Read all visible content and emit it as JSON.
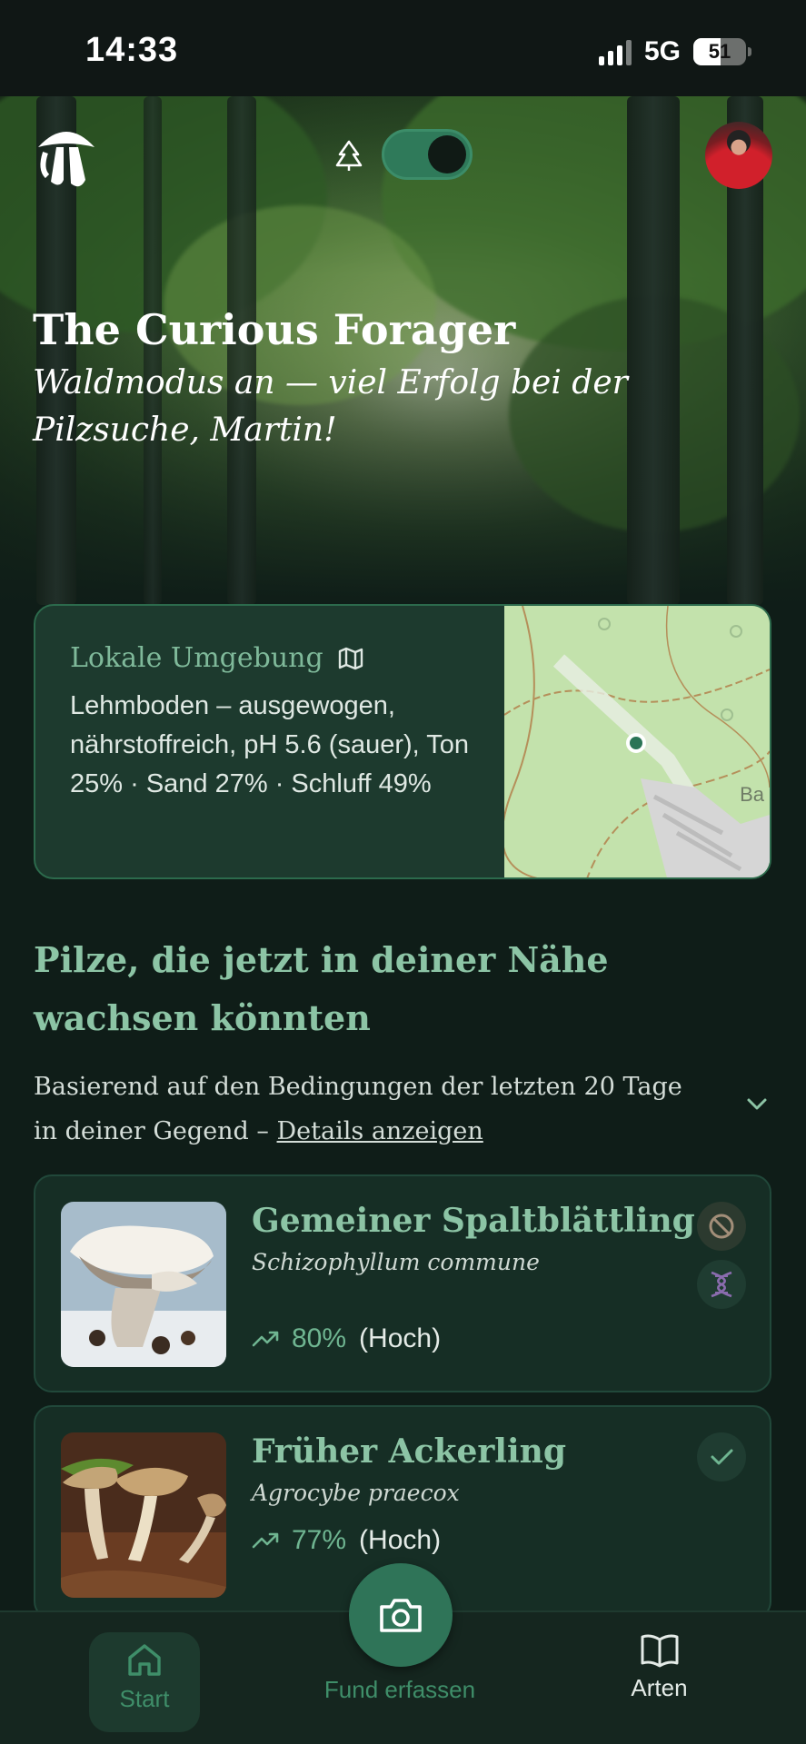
{
  "status_bar": {
    "time": "14:33",
    "network": "5G",
    "battery": "51"
  },
  "header": {
    "app_title": "The Curious Forager",
    "greeting": "Waldmodus an — viel Erfolg bei der Pilzsuche, Martin!",
    "forest_mode_on": true
  },
  "environment": {
    "label": "Lokale Umgebung",
    "description": "Lehmboden – ausgewogen, nährstoffreich, pH 5.6 (sauer), Ton 25% · Sand 27% · Schluff 49%",
    "map_label": "Ba"
  },
  "section": {
    "title": "Pilze, die jetzt in deiner Nähe wachsen könnten",
    "description": "Basierend auf den Bedingungen der letzten 20 Tage in deiner Gegend –",
    "details_link": "Details anzeigen"
  },
  "species": [
    {
      "name": "Gemeiner Spaltblättling",
      "latin": "Schizophyllum commune",
      "probability": "80%",
      "level": "(Hoch)"
    },
    {
      "name": "Früher Ackerling",
      "latin": "Agrocybe praecox",
      "probability": "77%",
      "level": "(Hoch)"
    }
  ],
  "nav": {
    "start": "Start",
    "capture": "Fund erfassen",
    "species": "Arten"
  },
  "colors": {
    "accent": "#8cc4a5",
    "primary": "#2f7458",
    "background": "#0f1d18"
  },
  "icons": [
    "mushroom-logo-icon",
    "tree-icon",
    "map-icon",
    "chevron-down-icon",
    "trend-up-icon",
    "forbidden-icon",
    "dna-icon",
    "check-icon",
    "camera-icon",
    "home-icon",
    "book-icon"
  ]
}
